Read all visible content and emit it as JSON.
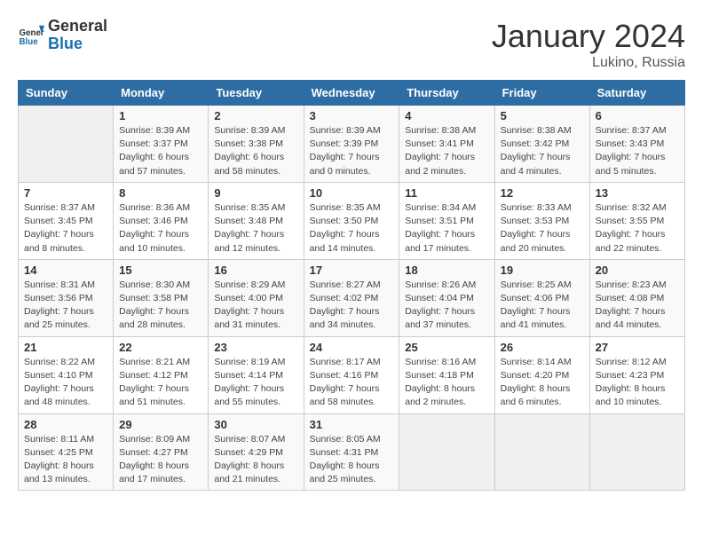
{
  "header": {
    "logo_general": "General",
    "logo_blue": "Blue",
    "month_title": "January 2024",
    "location": "Lukino, Russia"
  },
  "weekdays": [
    "Sunday",
    "Monday",
    "Tuesday",
    "Wednesday",
    "Thursday",
    "Friday",
    "Saturday"
  ],
  "weeks": [
    [
      {
        "day": "",
        "info": ""
      },
      {
        "day": "1",
        "info": "Sunrise: 8:39 AM\nSunset: 3:37 PM\nDaylight: 6 hours\nand 57 minutes."
      },
      {
        "day": "2",
        "info": "Sunrise: 8:39 AM\nSunset: 3:38 PM\nDaylight: 6 hours\nand 58 minutes."
      },
      {
        "day": "3",
        "info": "Sunrise: 8:39 AM\nSunset: 3:39 PM\nDaylight: 7 hours\nand 0 minutes."
      },
      {
        "day": "4",
        "info": "Sunrise: 8:38 AM\nSunset: 3:41 PM\nDaylight: 7 hours\nand 2 minutes."
      },
      {
        "day": "5",
        "info": "Sunrise: 8:38 AM\nSunset: 3:42 PM\nDaylight: 7 hours\nand 4 minutes."
      },
      {
        "day": "6",
        "info": "Sunrise: 8:37 AM\nSunset: 3:43 PM\nDaylight: 7 hours\nand 5 minutes."
      }
    ],
    [
      {
        "day": "7",
        "info": "Sunrise: 8:37 AM\nSunset: 3:45 PM\nDaylight: 7 hours\nand 8 minutes."
      },
      {
        "day": "8",
        "info": "Sunrise: 8:36 AM\nSunset: 3:46 PM\nDaylight: 7 hours\nand 10 minutes."
      },
      {
        "day": "9",
        "info": "Sunrise: 8:35 AM\nSunset: 3:48 PM\nDaylight: 7 hours\nand 12 minutes."
      },
      {
        "day": "10",
        "info": "Sunrise: 8:35 AM\nSunset: 3:50 PM\nDaylight: 7 hours\nand 14 minutes."
      },
      {
        "day": "11",
        "info": "Sunrise: 8:34 AM\nSunset: 3:51 PM\nDaylight: 7 hours\nand 17 minutes."
      },
      {
        "day": "12",
        "info": "Sunrise: 8:33 AM\nSunset: 3:53 PM\nDaylight: 7 hours\nand 20 minutes."
      },
      {
        "day": "13",
        "info": "Sunrise: 8:32 AM\nSunset: 3:55 PM\nDaylight: 7 hours\nand 22 minutes."
      }
    ],
    [
      {
        "day": "14",
        "info": "Sunrise: 8:31 AM\nSunset: 3:56 PM\nDaylight: 7 hours\nand 25 minutes."
      },
      {
        "day": "15",
        "info": "Sunrise: 8:30 AM\nSunset: 3:58 PM\nDaylight: 7 hours\nand 28 minutes."
      },
      {
        "day": "16",
        "info": "Sunrise: 8:29 AM\nSunset: 4:00 PM\nDaylight: 7 hours\nand 31 minutes."
      },
      {
        "day": "17",
        "info": "Sunrise: 8:27 AM\nSunset: 4:02 PM\nDaylight: 7 hours\nand 34 minutes."
      },
      {
        "day": "18",
        "info": "Sunrise: 8:26 AM\nSunset: 4:04 PM\nDaylight: 7 hours\nand 37 minutes."
      },
      {
        "day": "19",
        "info": "Sunrise: 8:25 AM\nSunset: 4:06 PM\nDaylight: 7 hours\nand 41 minutes."
      },
      {
        "day": "20",
        "info": "Sunrise: 8:23 AM\nSunset: 4:08 PM\nDaylight: 7 hours\nand 44 minutes."
      }
    ],
    [
      {
        "day": "21",
        "info": "Sunrise: 8:22 AM\nSunset: 4:10 PM\nDaylight: 7 hours\nand 48 minutes."
      },
      {
        "day": "22",
        "info": "Sunrise: 8:21 AM\nSunset: 4:12 PM\nDaylight: 7 hours\nand 51 minutes."
      },
      {
        "day": "23",
        "info": "Sunrise: 8:19 AM\nSunset: 4:14 PM\nDaylight: 7 hours\nand 55 minutes."
      },
      {
        "day": "24",
        "info": "Sunrise: 8:17 AM\nSunset: 4:16 PM\nDaylight: 7 hours\nand 58 minutes."
      },
      {
        "day": "25",
        "info": "Sunrise: 8:16 AM\nSunset: 4:18 PM\nDaylight: 8 hours\nand 2 minutes."
      },
      {
        "day": "26",
        "info": "Sunrise: 8:14 AM\nSunset: 4:20 PM\nDaylight: 8 hours\nand 6 minutes."
      },
      {
        "day": "27",
        "info": "Sunrise: 8:12 AM\nSunset: 4:23 PM\nDaylight: 8 hours\nand 10 minutes."
      }
    ],
    [
      {
        "day": "28",
        "info": "Sunrise: 8:11 AM\nSunset: 4:25 PM\nDaylight: 8 hours\nand 13 minutes."
      },
      {
        "day": "29",
        "info": "Sunrise: 8:09 AM\nSunset: 4:27 PM\nDaylight: 8 hours\nand 17 minutes."
      },
      {
        "day": "30",
        "info": "Sunrise: 8:07 AM\nSunset: 4:29 PM\nDaylight: 8 hours\nand 21 minutes."
      },
      {
        "day": "31",
        "info": "Sunrise: 8:05 AM\nSunset: 4:31 PM\nDaylight: 8 hours\nand 25 minutes."
      },
      {
        "day": "",
        "info": ""
      },
      {
        "day": "",
        "info": ""
      },
      {
        "day": "",
        "info": ""
      }
    ]
  ]
}
